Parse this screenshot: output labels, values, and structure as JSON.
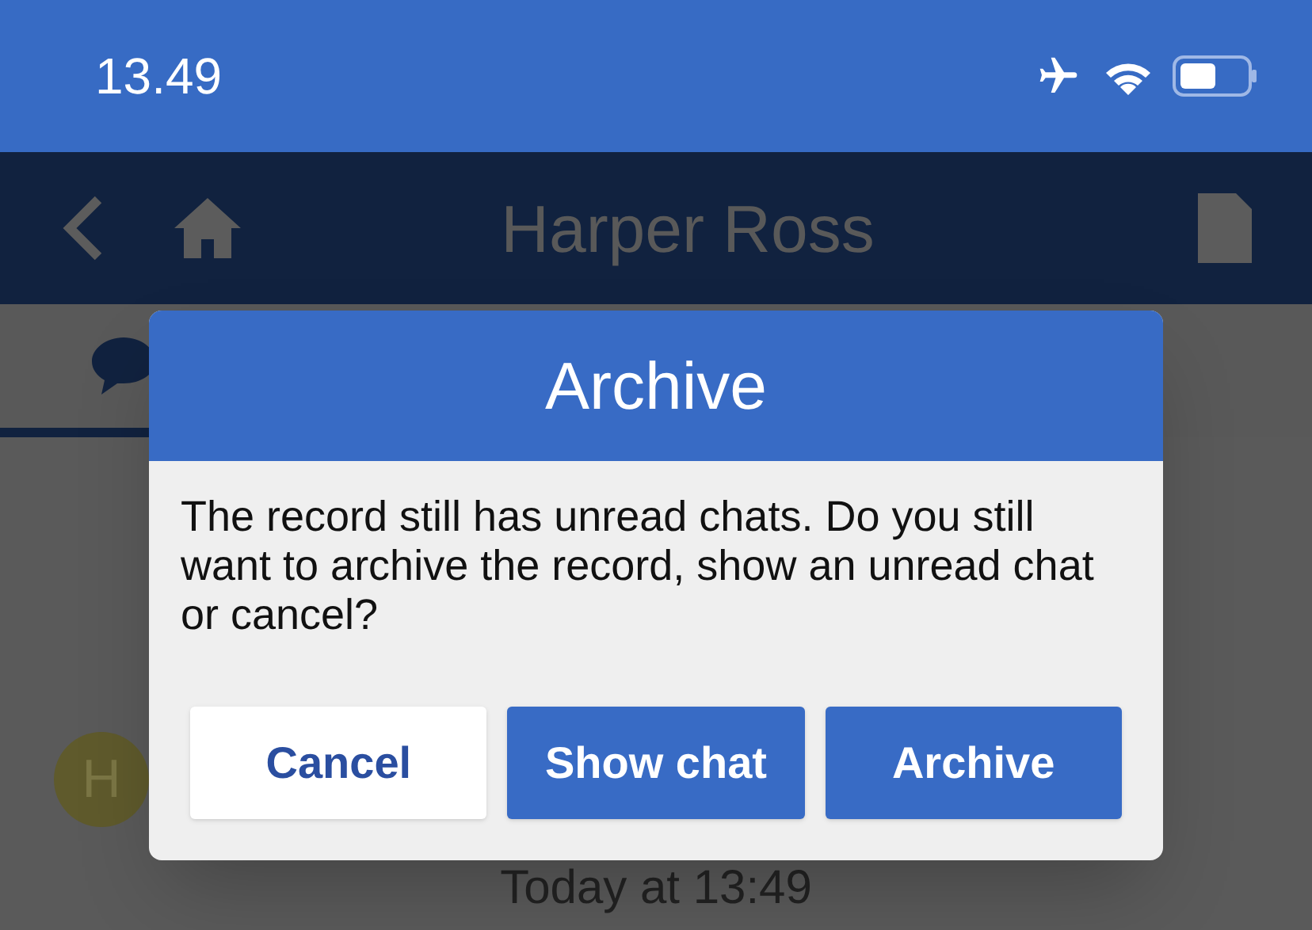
{
  "status_bar": {
    "time": "13.49"
  },
  "header": {
    "title": "Harper Ross"
  },
  "tabs": [
    {
      "selected": true
    }
  ],
  "chat": {
    "avatar_letter": "H",
    "timestamp": "Today at 13:49"
  },
  "dialog": {
    "title": "Archive",
    "message": "The record still has unread chats. Do you still want to archive the record, show an unread chat or cancel?",
    "buttons": [
      {
        "label": "Cancel",
        "kind": "secondary"
      },
      {
        "label": "Show chat",
        "kind": "primary"
      },
      {
        "label": "Archive",
        "kind": "primary"
      }
    ]
  }
}
